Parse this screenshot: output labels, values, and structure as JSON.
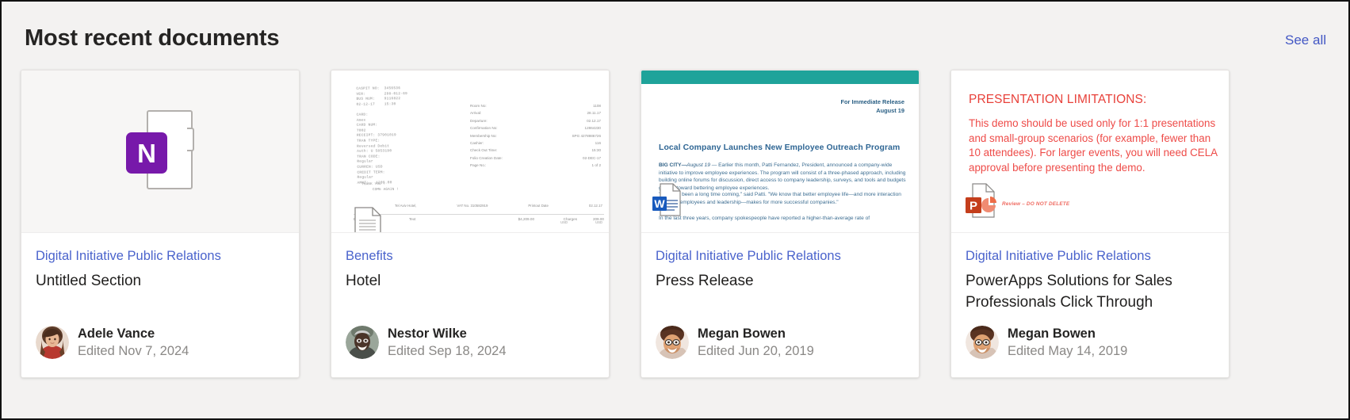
{
  "header": {
    "title": "Most recent documents",
    "see_all_label": "See all",
    "see_all_color": "#4257c4"
  },
  "cards": [
    {
      "site": "Digital Initiative Public Relations",
      "title": "Untitled Section",
      "author": "Adele Vance",
      "edited": "Edited Nov 7, 2024",
      "preview_type": "onenote-placeholder",
      "app_icon": "onenote-icon",
      "app_letter": "N",
      "app_color": "#7719aa"
    },
    {
      "site": "Benefits",
      "title": "Hotel",
      "author": "Nestor Wilke",
      "edited": "Edited Sep 18, 2024",
      "preview_type": "scanned-receipt",
      "app_icon": "generic-file-icon",
      "receipt": {
        "mono_block": "CASPIT NO:  3456536\nVER:        298-012-69\nBUS NUM:    9116822\n02-12-17    15:30\n\nCARD:\nAmex\nCARD NUM:\n7002\nRECEIPT: 37901019\nTRAN TYPE:\nReversed Debit\nAuth: U 5853190\nTRAN CODE:\nRegular\nCURREN: USD\nCREDIT TERM:\nRegular\nAMNT:   1209.00",
        "thanks": "THANK YOU !\n     COME AGAIN !",
        "fields": [
          {
            "label": "Room No:",
            "value": "1108"
          },
          {
            "label": "Arrival:",
            "value": "28.11.17"
          },
          {
            "label": "Departure:",
            "value": "02.12.17"
          },
          {
            "label": "Confirmation No:",
            "value": "12864230"
          },
          {
            "label": "Membership No:",
            "value": "SPG     4278986726"
          },
          {
            "label": "Cashier:",
            "value": "116"
          },
          {
            "label": "Check Out Time:",
            "value": "15:30"
          },
          {
            "label": "Folio Creation Date:",
            "value": "02-DEC-17"
          },
          {
            "label": "Page No.:",
            "value": "1 of 2"
          }
        ],
        "footline": [
          "Tel Aviv Hotel,",
          "VAT No. 310582919",
          "Printout Date",
          "02.12.17"
        ],
        "table_headers": [
          "Date",
          "Text",
          "$4,209.00",
          "Charges",
          "209.00"
        ],
        "table_sub": [
          "USD",
          "USD"
        ]
      }
    },
    {
      "site": "Digital Initiative Public Relations",
      "title": "Press Release",
      "author": "Megan Bowen",
      "edited": "Edited Jun 20, 2019",
      "preview_type": "word-press-release",
      "app_icon": "word-icon",
      "app_letter": "W",
      "app_color": "#185abd",
      "word": {
        "band_color": "#1fa39a",
        "release_line1": "For Immediate Release",
        "release_line2": "August 19",
        "headline": "Local Company Launches New Employee Outreach Program",
        "lead_bold": "BIG CITY—",
        "lead_italic": "August 19",
        "body": " — Earlier this month, Patti Fernandez, President, announced a company-wide initiative to improve employee experiences. The program will consist of a three-phased approach, including building online forums for discussion, direct access to company leadership, surveys, and tools and budgets geared toward bettering employee experiences.",
        "quote": "\"This has been a long time coming,\" said Patti. \"We know that better employee life—and more interaction between employees and leadership—makes for more successful companies.\"",
        "last_line": "In the last three years, company spokespeople have reported a higher-than-average rate of"
      }
    },
    {
      "site": "Digital Initiative Public Relations",
      "title": "PowerApps Solutions for Sales Professionals Click Through",
      "author": "Megan Bowen",
      "edited": "Edited May 14, 2019",
      "preview_type": "powerpoint-slide",
      "app_icon": "powerpoint-icon",
      "app_letter": "P",
      "app_color": "#c43e1c",
      "slide": {
        "title": "PRESENTATION LIMITATIONS:",
        "body": "This demo should be used only for 1:1 presentations and small-group scenarios (for example, fewer than 10 attendees). For larger events, you will need CELA approval before presenting the demo.",
        "note": "Review – DO NOT DELETE",
        "text_color": "#ee4b48"
      }
    }
  ]
}
